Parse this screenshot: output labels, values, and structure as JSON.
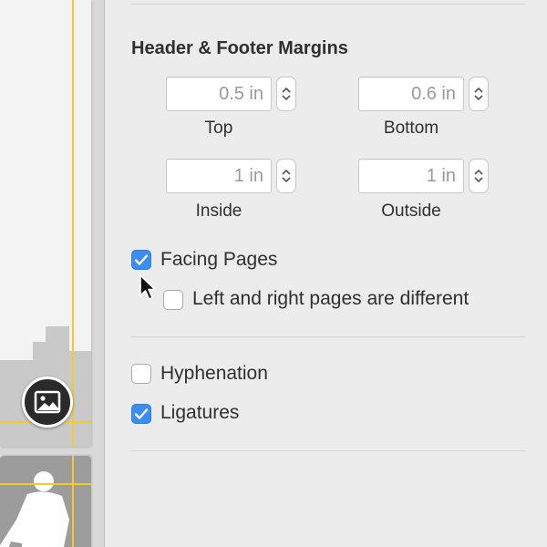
{
  "inspector": {
    "section_title": "Header & Footer Margins",
    "margins": {
      "top": {
        "value": "0.5 in",
        "label": "Top"
      },
      "bottom": {
        "value": "0.6 in",
        "label": "Bottom"
      },
      "inside": {
        "value": "1 in",
        "label": "Inside"
      },
      "outside": {
        "value": "1 in",
        "label": "Outside"
      }
    },
    "options": {
      "facing_pages": {
        "label": "Facing Pages",
        "checked": true
      },
      "left_right_different": {
        "label": "Left and right pages are different",
        "checked": false
      },
      "hyphenation": {
        "label": "Hyphenation",
        "checked": false
      },
      "ligatures": {
        "label": "Ligatures",
        "checked": true
      }
    }
  },
  "canvas": {
    "placeholder_icon": "image-icon"
  },
  "colors": {
    "accent": "#3b8df2",
    "guide": "#f1cc2a",
    "panel_background": "#ececec",
    "field_text": "#9a9a9a"
  }
}
